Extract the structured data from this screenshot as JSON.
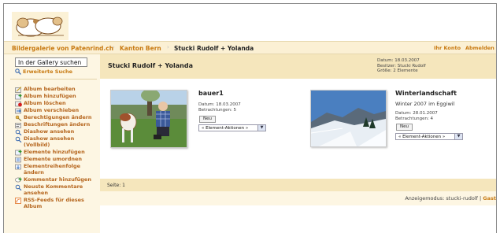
{
  "breadcrumb": {
    "root": "Bildergalerie von Patenrind.ch",
    "canton": "Kanton Bern",
    "current": "Stucki Rudolf + Yolanda"
  },
  "header": {
    "my_account": "Ihr Konto",
    "logout": "Abmelden"
  },
  "search": {
    "value": "In der Gallery suchen",
    "advanced": "Erweiterte Suche"
  },
  "sidebar": {
    "items": [
      {
        "label": "Album bearbeiten",
        "icon": "edit-album-icon"
      },
      {
        "label": "Album hinzufügen",
        "icon": "add-album-icon"
      },
      {
        "label": "Album löschen",
        "icon": "delete-album-icon"
      },
      {
        "label": "Album verschieben",
        "icon": "move-album-icon"
      },
      {
        "label": "Berechtigungen ändern",
        "icon": "permissions-icon"
      },
      {
        "label": "Beschriftungen ändern",
        "icon": "captions-icon"
      },
      {
        "label": "Diashow ansehen",
        "icon": "slideshow-icon"
      },
      {
        "label": "Diashow ansehen (Vollbild)",
        "icon": "slideshow-fullscreen-icon"
      },
      {
        "label": "Elemente hinzufügen",
        "icon": "add-items-icon"
      },
      {
        "label": "Elemente umordnen",
        "icon": "reorder-items-icon"
      },
      {
        "label": "Elementreihenfolge ändern",
        "icon": "item-order-icon"
      },
      {
        "label": "Kommentar hinzufügen",
        "icon": "add-comment-icon"
      },
      {
        "label": "Neuste Kommentare ansehen",
        "icon": "view-comments-icon"
      },
      {
        "label": "RSS-Feeds für dieses Album",
        "icon": "rss-icon"
      }
    ]
  },
  "album": {
    "title": "Stucki Rudolf + Yolanda",
    "date": "Datum: 18.03.2007",
    "owner": "Besitzer: Stucki Rudolf",
    "size": "Größe: 2 Elemente"
  },
  "items": [
    {
      "title": "bauer1",
      "subtitle": "",
      "date": "Datum: 18.03.2007",
      "views": "Betrachtungen: 5",
      "badge": "Neu",
      "actions": "« Element-Aktionen »"
    },
    {
      "title": "Winterlandschaft",
      "subtitle": "Winter 2007 im Eggiwil",
      "date": "Datum: 28.01.2007",
      "views": "Betrachtungen: 4",
      "badge": "Neu",
      "actions": "« Element-Aktionen »"
    }
  ],
  "pager": {
    "label": "Seite: 1"
  },
  "view_mode": {
    "text": "Anzeigemodus: stucki-rudolf |",
    "guest": "Gast"
  },
  "colors": {
    "accent": "#c87a12",
    "title_bar": "#f5e6bc",
    "sidebar_bg": "#fdf6e3"
  }
}
